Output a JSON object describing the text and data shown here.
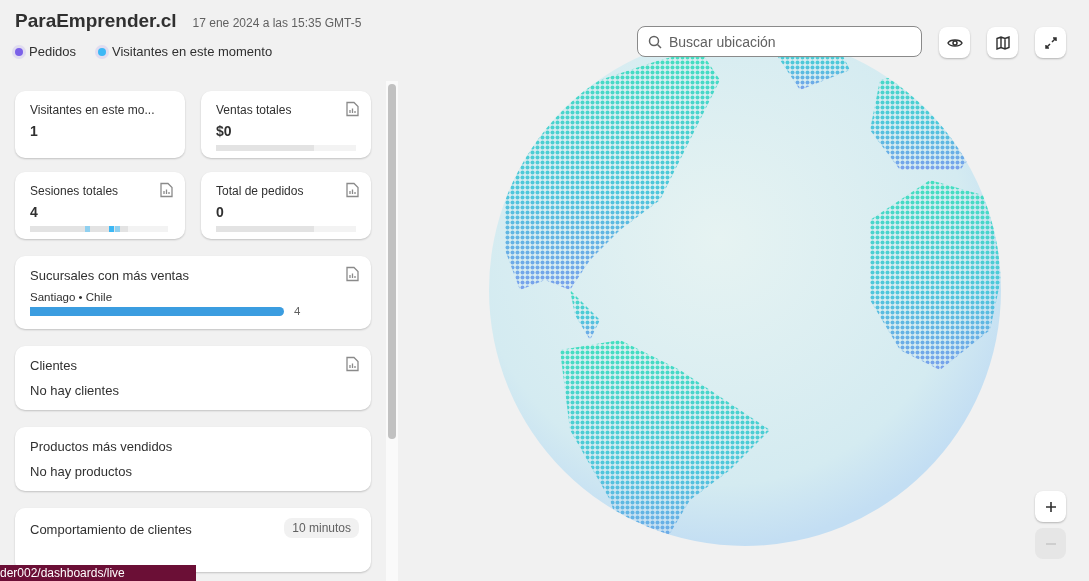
{
  "header": {
    "title": "ParaEmprender.cl",
    "timestamp": "17 ene 2024 a las 15:35 GMT-5"
  },
  "legend": [
    {
      "label": "Pedidos",
      "color": "#7b61e8"
    },
    {
      "label": "Visitantes en este momento",
      "color": "#3db8f5"
    }
  ],
  "metric_cards": [
    {
      "kind": "plain",
      "title": "Visitantes en este mo...",
      "value": "1",
      "report_icon": false
    },
    {
      "kind": "bar",
      "title": "Ventas totales",
      "value": "$0",
      "report_icon": true,
      "level": 0.7
    },
    {
      "kind": "sparkline",
      "title": "Sesiones totales",
      "value": "4",
      "report_icon": true
    },
    {
      "kind": "bar",
      "title": "Total de pedidos",
      "value": "0",
      "report_icon": true,
      "level": 0.7
    }
  ],
  "branches_card": {
    "title": "Sucursales con más ventas",
    "rows": [
      {
        "label": "Santiago • Chile",
        "count": "4",
        "level": 1
      }
    ]
  },
  "list_cards": [
    {
      "title": "Clientes",
      "empty_text": "No hay clientes",
      "report_icon": true
    },
    {
      "title": "Productos más vendidos",
      "empty_text": "No hay productos",
      "report_icon": false
    }
  ],
  "behavior_card": {
    "title": "Comportamiento de clientes",
    "badge": "10 minutos"
  },
  "map": {
    "search_placeholder": "Buscar ubicación",
    "zoom_out_disabled": true
  },
  "status_url": "der002/dashboards/live"
}
